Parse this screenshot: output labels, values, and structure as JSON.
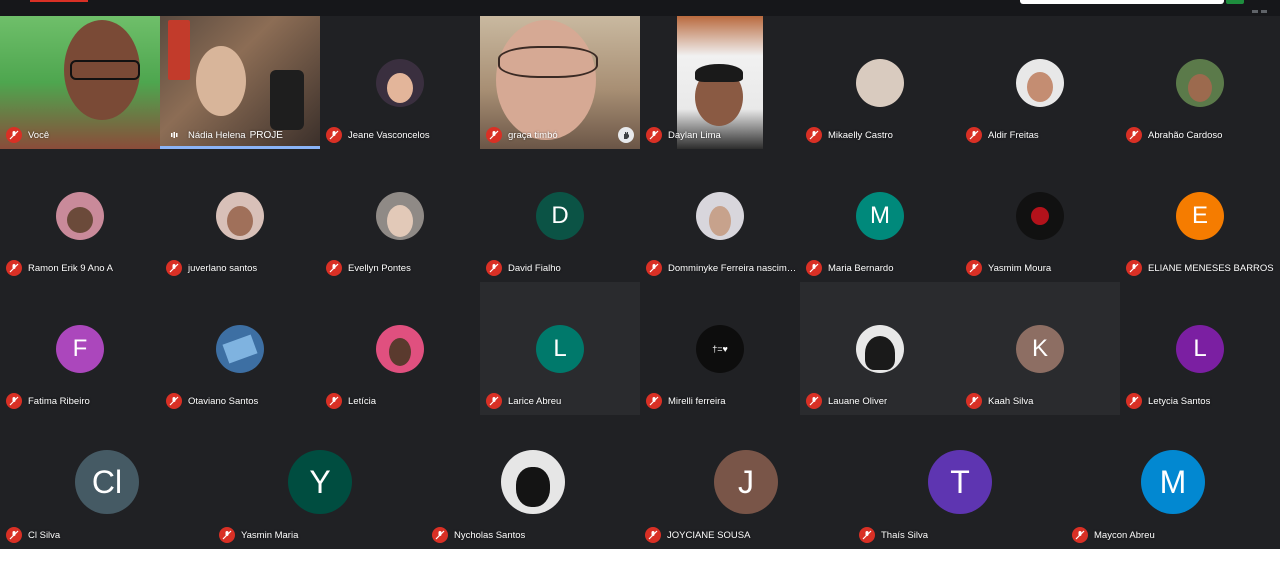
{
  "participants_row1": [
    {
      "name": "Você",
      "kind": "video"
    },
    {
      "name": "Nádia Helena",
      "overlay": "PROJE",
      "kind": "video"
    },
    {
      "name": "Jeane Vasconcelos",
      "kind": "photo",
      "color": "#3a2f3f"
    },
    {
      "name": "graça timbó",
      "kind": "video",
      "hand_raised": true
    },
    {
      "name": "Daylan Lima",
      "kind": "video"
    },
    {
      "name": "Mikaelly Castro",
      "kind": "photo",
      "color": "#d9cbbf"
    },
    {
      "name": "Aldir Freitas",
      "kind": "photo",
      "color": "#b58f7a"
    },
    {
      "name": "Abrahão Cardoso",
      "kind": "photo",
      "color": "#5b7a4a"
    }
  ],
  "participants_row2": [
    {
      "name": "Ramon Erik 9 Ano A",
      "kind": "photo",
      "color": "#c98a9a"
    },
    {
      "name": "juverlano santos",
      "kind": "photo",
      "color": "#c9a59a"
    },
    {
      "name": "Evellyn Pontes",
      "kind": "photo",
      "color": "#8f8a86"
    },
    {
      "name": "David Fialho",
      "kind": "initial",
      "initial": "D",
      "color": "#0b5345"
    },
    {
      "name": "Domminyke Ferreira nascim…",
      "kind": "photo",
      "color": "#d8d6dc"
    },
    {
      "name": "Maria Bernardo",
      "kind": "initial",
      "initial": "M",
      "color": "#00897b"
    },
    {
      "name": "Yasmim Moura",
      "kind": "photo",
      "color": "#111111"
    },
    {
      "name": "ELIANE MENESES BARROS",
      "kind": "initial",
      "initial": "E",
      "color": "#f57c00"
    }
  ],
  "participants_row3": [
    {
      "name": "Fatima Ribeiro",
      "kind": "initial",
      "initial": "F",
      "color": "#ab47bc"
    },
    {
      "name": "Otaviano Santos",
      "kind": "photo",
      "color": "#3d6fa3"
    },
    {
      "name": "Letícia",
      "kind": "photo",
      "color": "#e0507f"
    },
    {
      "name": "Larice Abreu",
      "kind": "initial",
      "initial": "L",
      "color": "#00796b"
    },
    {
      "name": "Mirelli ferreira",
      "kind": "photo",
      "color": "#0d0d0d",
      "glyph": "†=♥"
    },
    {
      "name": "Lauane Oliver",
      "kind": "photo",
      "color": "#2b2b2b"
    },
    {
      "name": "Kaah Silva",
      "kind": "initial",
      "initial": "K",
      "color": "#8d6e63"
    },
    {
      "name": "Letycia Santos",
      "kind": "initial",
      "initial": "L",
      "color": "#7b1fa2"
    }
  ],
  "participants_row4": [
    {
      "name": "Cl Silva",
      "kind": "initial",
      "initial": "Cl",
      "color": "#455a64"
    },
    {
      "name": "Yasmin Maria",
      "kind": "initial",
      "initial": "Y",
      "color": "#004d40"
    },
    {
      "name": "Nycholas Santos",
      "kind": "photo",
      "color": "#e6e6e6"
    },
    {
      "name": "JOYCIANE SOUSA",
      "kind": "initial",
      "initial": "J",
      "color": "#795548"
    },
    {
      "name": "Thaís Silva",
      "kind": "initial",
      "initial": "T",
      "color": "#5e35b1"
    },
    {
      "name": "Maycon Abreu",
      "kind": "initial",
      "initial": "M",
      "color": "#0288d1"
    }
  ]
}
